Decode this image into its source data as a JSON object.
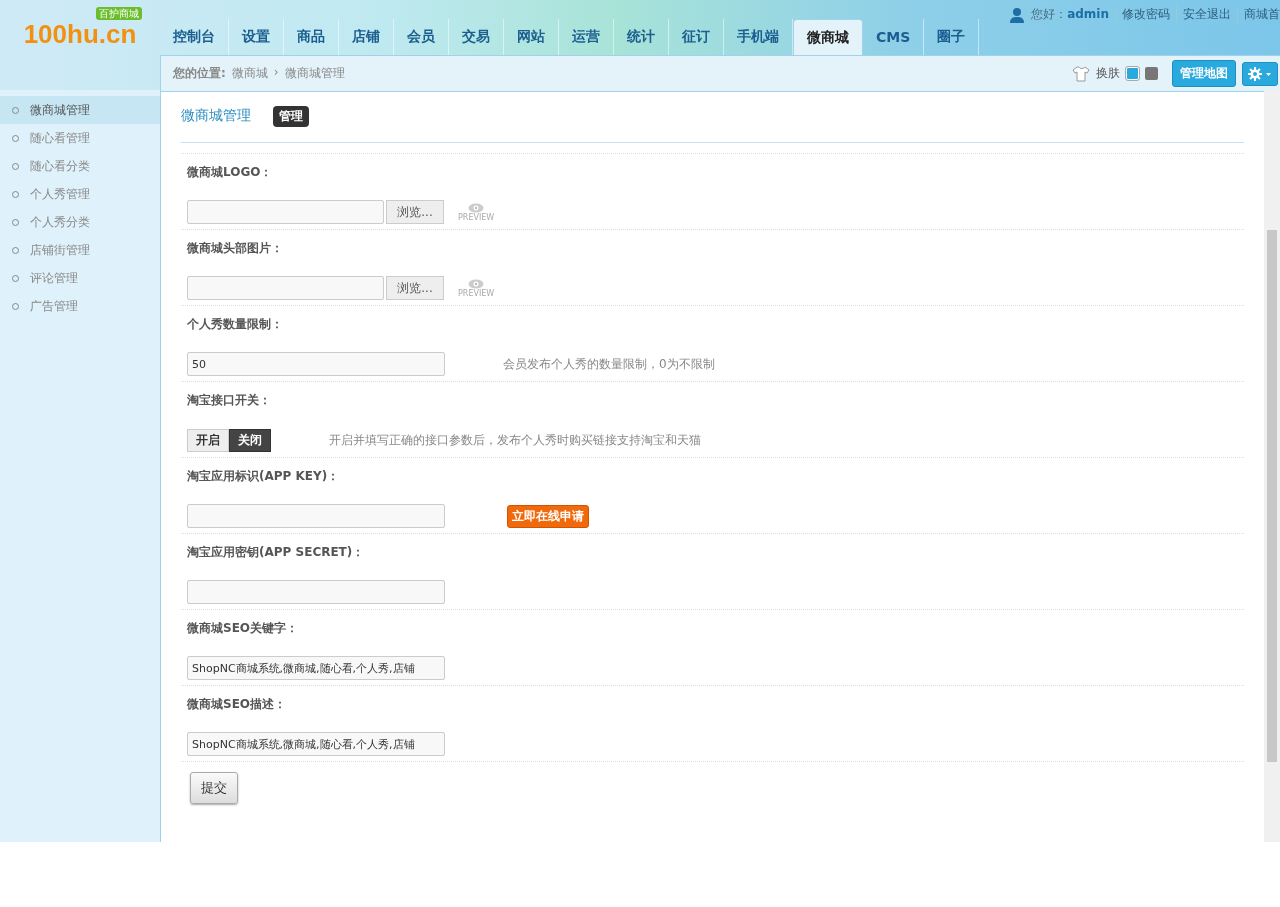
{
  "logo": {
    "text": "100hu.cn",
    "badge": "百护商城"
  },
  "nav": [
    {
      "label": "控制台",
      "selected": false
    },
    {
      "label": "设置",
      "selected": false
    },
    {
      "label": "商品",
      "selected": false
    },
    {
      "label": "店铺",
      "selected": false
    },
    {
      "label": "会员",
      "selected": false
    },
    {
      "label": "交易",
      "selected": false
    },
    {
      "label": "网站",
      "selected": false
    },
    {
      "label": "运营",
      "selected": false
    },
    {
      "label": "统计",
      "selected": false
    },
    {
      "label": "征订",
      "selected": false
    },
    {
      "label": "手机端",
      "selected": false
    },
    {
      "label": "微商城",
      "selected": true
    },
    {
      "label": "CMS",
      "selected": false
    },
    {
      "label": "圈子",
      "selected": false
    }
  ],
  "user_bar": {
    "greeting": "您好：",
    "user": "admin",
    "links": [
      "修改密码",
      "安全退出",
      "商城首"
    ]
  },
  "breadcrumb": {
    "label": "您的位置:",
    "items": [
      "微商城",
      "微商城管理"
    ],
    "separator": "›"
  },
  "skin": {
    "label": "换肤",
    "options": [
      {
        "color": "#29a9de",
        "selected": true
      },
      {
        "color": "#777777",
        "selected": false
      }
    ]
  },
  "map_button": "管理地图",
  "sidebar": [
    {
      "label": "微商城管理",
      "selected": true
    },
    {
      "label": "随心看管理",
      "selected": false
    },
    {
      "label": "随心看分类",
      "selected": false
    },
    {
      "label": "个人秀管理",
      "selected": false
    },
    {
      "label": "个人秀分类",
      "selected": false
    },
    {
      "label": "店铺街管理",
      "selected": false
    },
    {
      "label": "评论管理",
      "selected": false
    },
    {
      "label": "广告管理",
      "selected": false
    }
  ],
  "page": {
    "title": "微商城管理",
    "tag": "管理"
  },
  "fields": [
    {
      "kind": "file",
      "label": "微商城LOGO：",
      "button": "浏览...",
      "preview": "PREVIEW"
    },
    {
      "kind": "file",
      "label": "微商城头部图片：",
      "button": "浏览...",
      "preview": "PREVIEW"
    },
    {
      "kind": "text",
      "label": "个人秀数量限制：",
      "value": "50",
      "hint": "会员发布个人秀的数量限制，0为不限制"
    },
    {
      "kind": "switch",
      "label": "淘宝接口开关：",
      "options": [
        {
          "label": "开启",
          "selected": false
        },
        {
          "label": "关闭",
          "selected": true
        }
      ],
      "hint": "开启并填写正确的接口参数后，发布个人秀时购买链接支持淘宝和天猫"
    },
    {
      "kind": "text",
      "label": "淘宝应用标识(APP KEY)：",
      "action": "立即在线申请"
    },
    {
      "kind": "text",
      "label": "淘宝应用密钥(APP SECRET)："
    },
    {
      "kind": "text",
      "label": "微商城SEO关键字：",
      "value": "ShopNC商城系统,微商城,随心看,个人秀,店铺"
    },
    {
      "kind": "text",
      "label": "微商城SEO描述：",
      "value": "ShopNC商城系统,微商城,随心看,个人秀,店铺"
    }
  ],
  "submit": "提交"
}
